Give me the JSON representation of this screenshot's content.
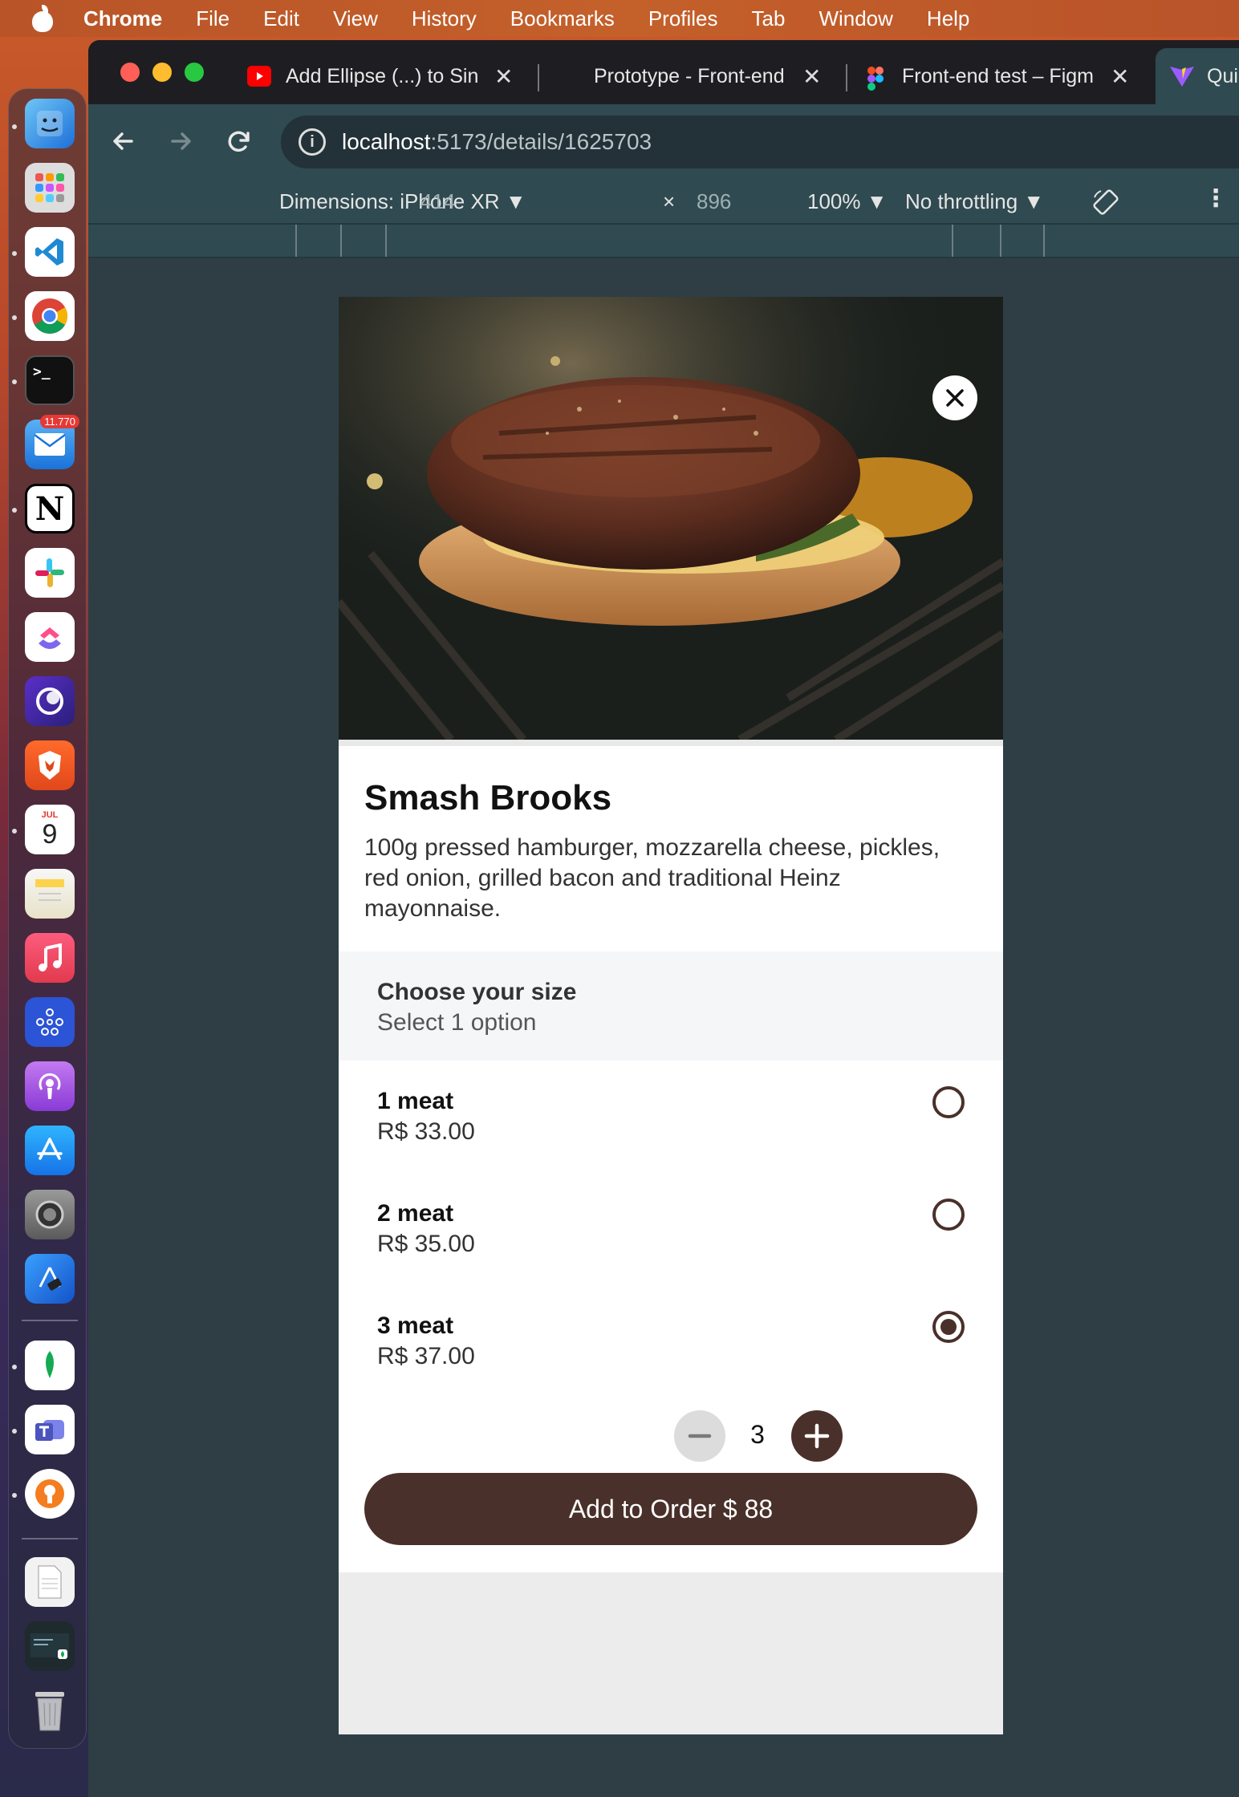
{
  "menubar": {
    "app": "Chrome",
    "items": [
      "File",
      "Edit",
      "View",
      "History",
      "Bookmarks",
      "Profiles",
      "Tab",
      "Window",
      "Help"
    ]
  },
  "dock": {
    "mail_badge": "11.770",
    "calendar_month": "JUL",
    "calendar_day": "9"
  },
  "tabs": [
    {
      "label": "Add Ellipse (...) to Sin",
      "close": "✕"
    },
    {
      "label": "Prototype - Front-end",
      "close": "✕"
    },
    {
      "label": "Front-end test – Figma",
      "close": "✕"
    },
    {
      "label": "Qui"
    }
  ],
  "address": {
    "host": "localhost",
    "path": ":5173/details/1625703"
  },
  "devtools": {
    "dimensions": "Dimensions: iPhone XR",
    "width": "414",
    "times": "×",
    "height": "896",
    "zoom": "100%",
    "throttling": "No throttling"
  },
  "product": {
    "title": "Smash Brooks",
    "description": "100g pressed hamburger, mozzarella cheese, pickles, red onion, grilled bacon and traditional Heinz mayonnaise."
  },
  "size_section": {
    "title": "Choose your size",
    "subtitle": "Select 1 option",
    "options": [
      {
        "name": "1 meat",
        "price": "R$ 33.00",
        "selected": false
      },
      {
        "name": "2 meat",
        "price": "R$ 35.00",
        "selected": false
      },
      {
        "name": "3 meat",
        "price": "R$ 37.00",
        "selected": true
      }
    ]
  },
  "quantity": "3",
  "order_button": "Add to Order $ 88",
  "colors": {
    "accent": "#4a302a",
    "section_bg": "#f5f6f7"
  }
}
